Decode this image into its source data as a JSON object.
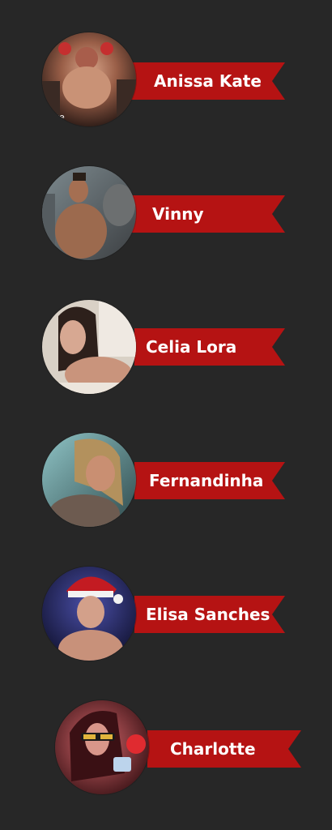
{
  "page": {
    "background": "#272727",
    "banner_color": "#b51313"
  },
  "performers": [
    {
      "name": "Anissa Kate",
      "avatar_icon": "performer-photo",
      "avatar_caption": "ate"
    },
    {
      "name": "Vinny",
      "avatar_icon": "performer-photo"
    },
    {
      "name": "Celia Lora",
      "avatar_icon": "performer-photo"
    },
    {
      "name": "Fernandinha",
      "avatar_icon": "performer-photo"
    },
    {
      "name": "Elisa Sanches",
      "avatar_icon": "performer-photo"
    },
    {
      "name": "Charlotte",
      "avatar_icon": "performer-photo"
    }
  ]
}
